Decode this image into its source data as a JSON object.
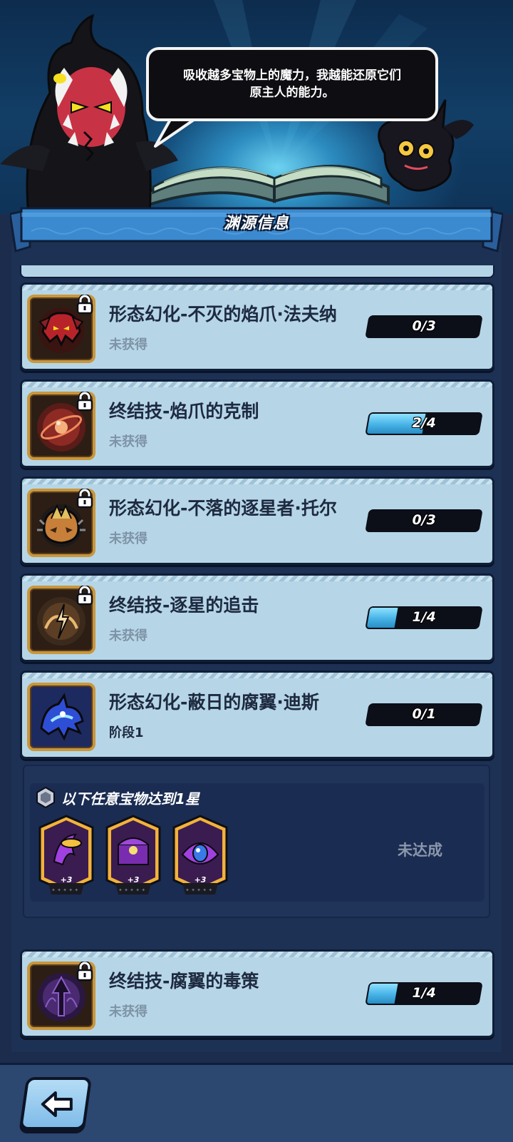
{
  "header": {
    "speech_bubble": "吸收越多宝物上的魔力，我越能还原它们\n原主人的能力。",
    "panel_title": "渊源信息"
  },
  "cards": [
    {
      "title": "形态幻化-不灭的焰爪·法夫纳",
      "status": "未获得",
      "progress_text": "0/3",
      "progress": 0.0,
      "locked": true,
      "icon": "red-dragon-head-icon"
    },
    {
      "title": "终结技-焰爪的克制",
      "status": "未获得",
      "progress_text": "2/4",
      "progress": 0.5,
      "locked": true,
      "icon": "flame-orb-icon"
    },
    {
      "title": "形态幻化-不落的逐星者·托尔",
      "status": "未获得",
      "progress_text": "0/3",
      "progress": 0.0,
      "locked": true,
      "icon": "spiked-helmet-icon"
    },
    {
      "title": "终结技-逐星的追击",
      "status": "未获得",
      "progress_text": "1/4",
      "progress": 0.25,
      "locked": true,
      "icon": "lightning-orb-icon"
    },
    {
      "title": "形态幻化-蔽日的腐翼·迪斯",
      "status": "阶段1",
      "progress_text": "0/1",
      "progress": 0.0,
      "locked": false,
      "icon": "blue-wing-creature-icon"
    },
    {
      "title": "终结技-腐翼的毒策",
      "status": "未获得",
      "progress_text": "1/4",
      "progress": 0.25,
      "locked": true,
      "icon": "dark-arrow-orb-icon"
    }
  ],
  "requirement": {
    "title": "以下任意宝物达到1星",
    "status": "未达成",
    "treasures": [
      {
        "icon": "purple-horn-treasure-icon",
        "level": "+3"
      },
      {
        "icon": "purple-chest-treasure-icon",
        "level": "+3"
      },
      {
        "icon": "purple-eye-treasure-icon",
        "level": "+3"
      }
    ]
  },
  "colors": {
    "card_bg": "#b6d6e7",
    "progress_fill": "#46b2e6",
    "frame_gold": "#c9963c",
    "panel_bg": "#1d3154"
  }
}
